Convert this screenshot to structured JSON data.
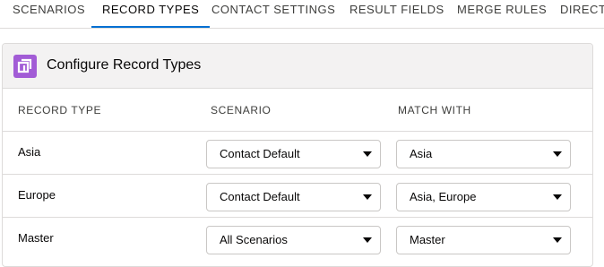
{
  "tabs": [
    {
      "label": "SCENARIOS",
      "active": false
    },
    {
      "label": "RECORD TYPES",
      "active": true
    },
    {
      "label": "CONTACT SETTINGS",
      "active": false
    },
    {
      "label": "RESULT FIELDS",
      "active": false
    },
    {
      "label": "MERGE RULES",
      "active": false
    },
    {
      "label": "DIRECT",
      "active": false
    }
  ],
  "card": {
    "title": "Configure Record Types",
    "icon": "record-types-icon",
    "icon_color": "#a25cd6"
  },
  "table": {
    "columns": [
      "RECORD TYPE",
      "SCENARIO",
      "MATCH WITH"
    ],
    "rows": [
      {
        "record_type": "Asia",
        "scenario": "Contact Default",
        "match_with": "Asia"
      },
      {
        "record_type": "Europe",
        "scenario": "Contact Default",
        "match_with": "Asia, Europe"
      },
      {
        "record_type": "Master",
        "scenario": "All Scenarios",
        "match_with": "Master"
      }
    ]
  },
  "colors": {
    "accent": "#0070d2",
    "border": "#dddbda",
    "header_bg": "#f3f2f2"
  }
}
